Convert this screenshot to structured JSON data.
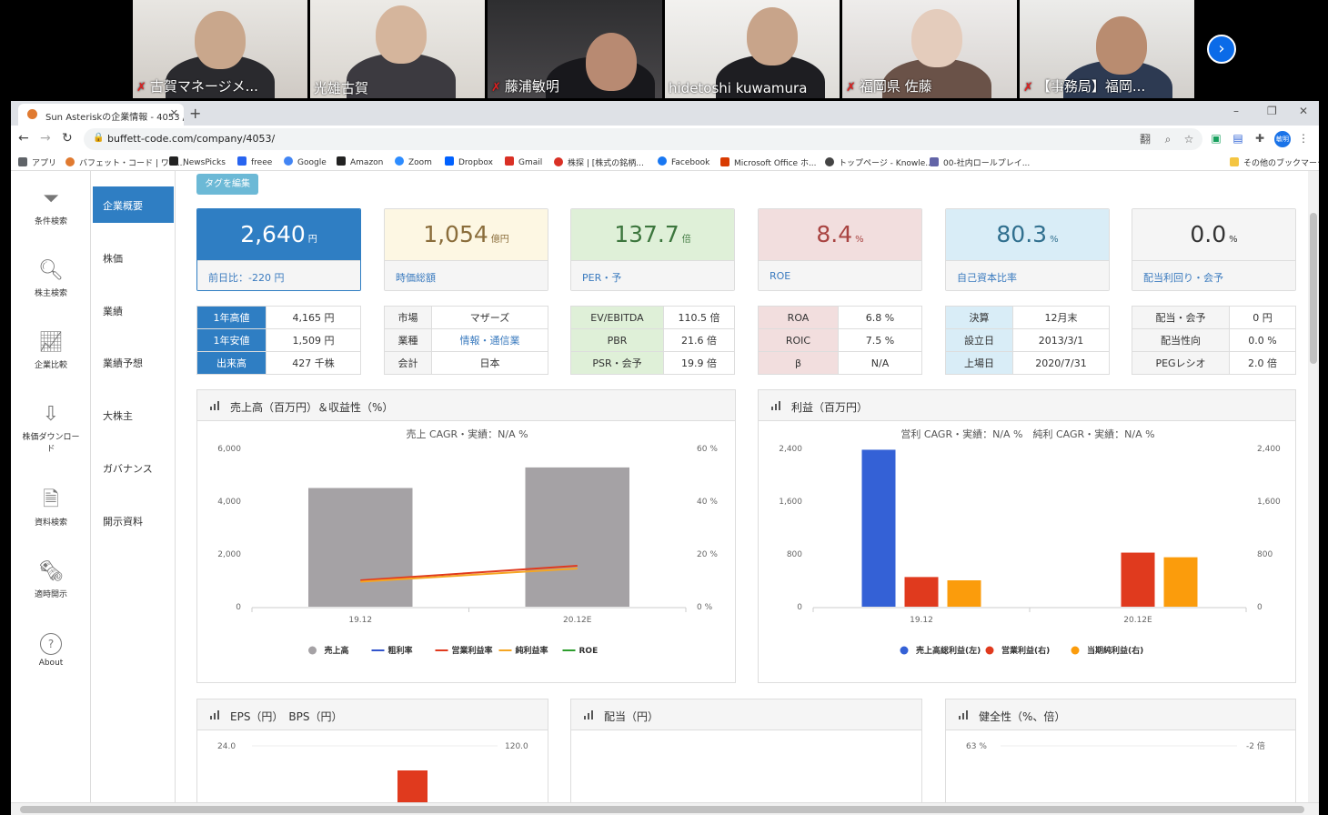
{
  "participants": [
    {
      "name": "古賀マネージメ...",
      "muted": true
    },
    {
      "name": "光雄古賀",
      "muted": false
    },
    {
      "name": "藤浦敏明",
      "muted": true
    },
    {
      "name": "hidetoshi kuwamura",
      "muted": false
    },
    {
      "name": "福岡県 佐藤",
      "muted": true
    },
    {
      "name": "【事務局】福岡...",
      "muted": true
    }
  ],
  "video_next_icon": "chevron-right-icon",
  "browser": {
    "tab_title": "Sun Asteriskの企業情報 - 4053 /",
    "new_tab": "+",
    "url": "buffett-code.com/company/4053/",
    "window": {
      "minimize": "–",
      "restore": "❐",
      "close": "✕"
    },
    "nav": {
      "back": "←",
      "forward": "→",
      "reload": "↻"
    },
    "toolbar_icons": {
      "translate": "翻",
      "zoom": "⌕",
      "bookmark": "☆",
      "ext1": "▣",
      "ext2": "▤",
      "extensions": "✚",
      "menu": "⋮"
    },
    "profile": "敏明",
    "bookmarks": [
      {
        "label": "アプリ",
        "color": "#5f6368"
      },
      {
        "label": "バフェット・コード | ワン...",
        "color": "#e07a30"
      },
      {
        "label": "NewsPicks",
        "color": "#222222"
      },
      {
        "label": "freee",
        "color": "#2864f0"
      },
      {
        "label": "Google",
        "color": "#4285f4"
      },
      {
        "label": "Amazon",
        "color": "#222222"
      },
      {
        "label": "Zoom",
        "color": "#2d8cff"
      },
      {
        "label": "Dropbox",
        "color": "#0061ff"
      },
      {
        "label": "Gmail",
        "color": "#d93025"
      },
      {
        "label": "株探 | [株式の銘柄...",
        "color": "#d93025"
      },
      {
        "label": "Facebook",
        "color": "#1877f2"
      },
      {
        "label": "Microsoft Office ホ...",
        "color": "#d83b01"
      },
      {
        "label": "トップページ - Knowle...",
        "color": "#444444"
      },
      {
        "label": "00-社内ロールプレイ...",
        "color": "#6264a7"
      }
    ],
    "other_bookmarks": "その他のブックマーク"
  },
  "left_nav": [
    {
      "label": "条件検索",
      "icon": "filter-icon"
    },
    {
      "label": "株主検索",
      "icon": "search-icon"
    },
    {
      "label": "企業比較",
      "icon": "chart-compare-icon"
    },
    {
      "label": "株価ダウンロード",
      "icon": "download-icon"
    },
    {
      "label": "資料検索",
      "icon": "document-search-icon"
    },
    {
      "label": "適時開示",
      "icon": "disclosure-icon"
    },
    {
      "label": "About",
      "icon": "question-icon"
    }
  ],
  "sub_nav": [
    "企業概要",
    "株価",
    "業績",
    "業績予想",
    "大株主",
    "ガバナンス",
    "開示資料"
  ],
  "tag_button": "タグを編集",
  "kpis": [
    {
      "value": "2,640",
      "unit": "円",
      "label": "前日比：-220 円"
    },
    {
      "value": "1,054",
      "unit": "億円",
      "label": "時価総額"
    },
    {
      "value": "137.7",
      "unit": "倍",
      "label": "PER・予"
    },
    {
      "value": "8.4",
      "unit": "%",
      "label": "ROE"
    },
    {
      "value": "80.3",
      "unit": "%",
      "label": "自己資本比率"
    },
    {
      "value": "0.0",
      "unit": "%",
      "label": "配当利回り・会予"
    }
  ],
  "detail_tables": [
    [
      [
        "1年高値",
        "4,165 円"
      ],
      [
        "1年安値",
        "1,509 円"
      ],
      [
        "出来高",
        "427 千株"
      ]
    ],
    [
      [
        "市場",
        "マザーズ"
      ],
      [
        "業種",
        "情報・通信業"
      ],
      [
        "会計",
        "日本"
      ]
    ],
    [
      [
        "EV/EBITDA",
        "110.5 倍"
      ],
      [
        "PBR",
        "21.6 倍"
      ],
      [
        "PSR・会予",
        "19.9 倍"
      ]
    ],
    [
      [
        "ROA",
        "6.8 %"
      ],
      [
        "ROIC",
        "7.5 %"
      ],
      [
        "β",
        "N/A"
      ]
    ],
    [
      [
        "決算",
        "12月末"
      ],
      [
        "設立日",
        "2013/3/1"
      ],
      [
        "上場日",
        "2020/7/31"
      ]
    ],
    [
      [
        "配当・会予",
        "0 円"
      ],
      [
        "配当性向",
        "0.0 %"
      ],
      [
        "PEGレシオ",
        "2.0 倍"
      ]
    ]
  ],
  "colors": {
    "primary": "#2f7ec3",
    "kpi_backgrounds": [
      "#2f7ec3",
      "#fdf7e3",
      "#dff0d8",
      "#f2dede",
      "#d9edf7",
      "#f5f5f5"
    ],
    "kpi_text": [
      "#ffffff",
      "#8a6d3b",
      "#3c763d",
      "#a94442",
      "#31708f",
      "#333333"
    ],
    "table_heads": [
      "#2f7ec3",
      "#f5f5f5",
      "#dff0d8",
      "#f2dede",
      "#d9edf7",
      "#f5f5f5"
    ],
    "table_head_text": [
      "#ffffff",
      "#333333",
      "#333333",
      "#333333",
      "#333333",
      "#333333"
    ]
  },
  "panels": {
    "sales": "売上高（百万円）＆収益性（%）",
    "profit": "利益（百万円）",
    "eps": "EPS（円）　BPS（円）",
    "dividend": "配当（円）",
    "health": "健全性（%、倍）"
  },
  "chart_data": [
    {
      "type": "bar",
      "title": "売上 CAGR・実績：N/A %",
      "categories": [
        "19.12",
        "20.12E"
      ],
      "ylim": [
        0,
        6000
      ],
      "y2lim": [
        0,
        60
      ],
      "yticks": [
        "0",
        "2,000",
        "4,000",
        "6,000"
      ],
      "y2ticks": [
        "0 %",
        "20 %",
        "40 %",
        "60 %"
      ],
      "series": [
        {
          "name": "売上高",
          "axis": "left",
          "kind": "bar",
          "color": "#a5a2a5",
          "values": [
            4500,
            5280
          ]
        },
        {
          "name": "粗利率",
          "axis": "right",
          "kind": "line",
          "color": "#3355cc",
          "values": [
            null,
            null
          ]
        },
        {
          "name": "営業利益率",
          "axis": "right",
          "kind": "line",
          "color": "#e03a1e",
          "values": [
            10,
            15.5
          ]
        },
        {
          "name": "純利益率",
          "axis": "right",
          "kind": "line",
          "color": "#f5a623",
          "values": [
            9.5,
            14.5
          ]
        },
        {
          "name": "ROE",
          "axis": "right",
          "kind": "line",
          "color": "#2e9e2e",
          "values": [
            null,
            null
          ]
        }
      ]
    },
    {
      "type": "bar",
      "title": "営利 CAGR・実績：N/A %　純利 CAGR・実績：N/A %",
      "categories": [
        "19.12",
        "20.12E"
      ],
      "ylim": [
        0,
        2400
      ],
      "y2lim": [
        0,
        2400
      ],
      "yticks": [
        "0",
        "800",
        "1,600",
        "2,400"
      ],
      "y2ticks": [
        "0",
        "800",
        "1,600",
        "2,400"
      ],
      "series": [
        {
          "name": "売上高総利益(左)",
          "color": "#3461d6",
          "values": [
            2380,
            null
          ]
        },
        {
          "name": "営業利益(右)",
          "color": "#e03a1e",
          "values": [
            450,
            820
          ]
        },
        {
          "name": "当期純利益(右)",
          "color": "#fb9c0c",
          "values": [
            400,
            750
          ]
        }
      ]
    },
    {
      "type": "bar",
      "title": "",
      "yticks": [
        "24.0"
      ],
      "y2ticks": [
        "120.0"
      ],
      "visible_partial": true
    },
    {
      "type": "line",
      "title": "",
      "yticks": [
        "63 %"
      ],
      "y2ticks": [
        "-2 倍"
      ],
      "visible_partial": true
    }
  ]
}
